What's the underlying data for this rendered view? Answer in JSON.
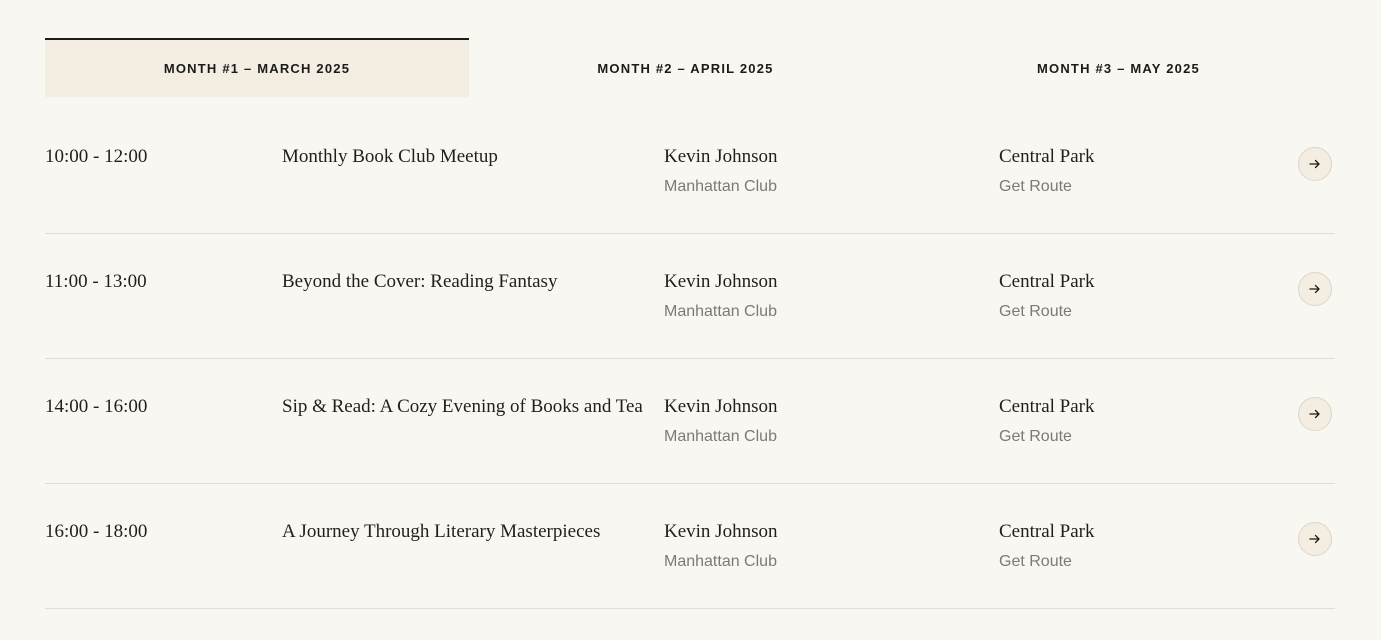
{
  "tabs": [
    {
      "label": "MONTH #1 – MARCH 2025",
      "active": true
    },
    {
      "label": "MONTH #2 – APRIL 2025",
      "active": false
    },
    {
      "label": "MONTH #3 – MAY 2025",
      "active": false
    }
  ],
  "events": [
    {
      "time": "10:00 - 12:00",
      "title": "Monthly Book Club Meetup",
      "host": "Kevin Johnson",
      "club": "Manhattan Club",
      "venue": "Central Park",
      "route": "Get Route",
      "icon": "arrow-right-icon"
    },
    {
      "time": "11:00 - 13:00",
      "title": "Beyond the Cover: Reading Fantasy",
      "host": "Kevin Johnson",
      "club": "Manhattan Club",
      "venue": "Central Park",
      "route": "Get Route",
      "icon": "arrow-right-icon"
    },
    {
      "time": "14:00 - 16:00",
      "title": "Sip & Read: A Cozy Evening of Books and Tea",
      "host": "Kevin Johnson",
      "club": "Manhattan Club",
      "venue": "Central Park",
      "route": "Get Route",
      "icon": "arrow-right-icon"
    },
    {
      "time": "16:00 - 18:00",
      "title": "A Journey Through Literary Masterpieces",
      "host": "Kevin Johnson",
      "club": "Manhattan Club",
      "venue": "Central Park",
      "route": "Get Route",
      "icon": "arrow-right-icon"
    }
  ],
  "colors": {
    "background": "#f9f7f2",
    "active_tab_background": "#f3ede2",
    "text": "#1f1f1f",
    "muted_text": "#7c7a76",
    "divider": "#e4ddd2"
  }
}
